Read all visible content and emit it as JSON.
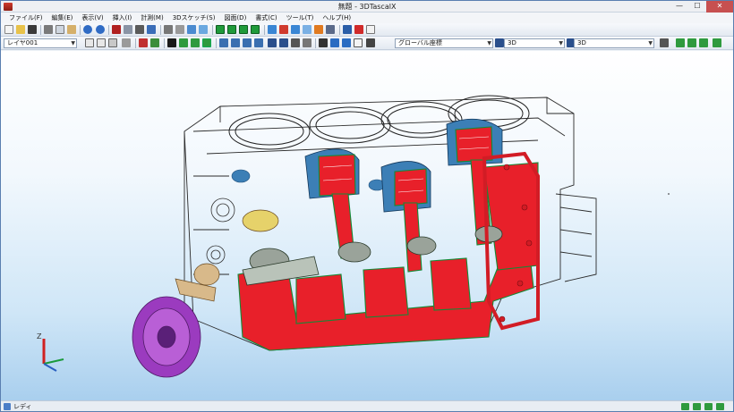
{
  "window": {
    "title": "無題 - 3DTascalX"
  },
  "window_controls": {
    "minimize": "—",
    "maximize": "☐",
    "close": "✕"
  },
  "menu": {
    "items": [
      {
        "label": "ファイル(F)"
      },
      {
        "label": "編集(E)"
      },
      {
        "label": "表示(V)"
      },
      {
        "label": "挿入(I)"
      },
      {
        "label": "計測(M)"
      },
      {
        "label": "3Dスケッチ(S)"
      },
      {
        "label": "図面(D)"
      },
      {
        "label": "書式(C)"
      },
      {
        "label": "ツール(T)"
      },
      {
        "label": "ヘルプ(H)"
      }
    ]
  },
  "toolbar2": {
    "layer_select": "レイヤ001",
    "coordinate_select": "グローバル座標",
    "view_select_1": "3D",
    "view_select_2": "3D"
  },
  "axis_triad": {
    "z_label": "Z"
  },
  "status": {
    "text": "レディ"
  },
  "colors": {
    "section_red": "#e8202a",
    "piston_blue": "#3c7fb6",
    "wire_green": "#1b8a3a",
    "background_bottom": "#a9cfee"
  }
}
